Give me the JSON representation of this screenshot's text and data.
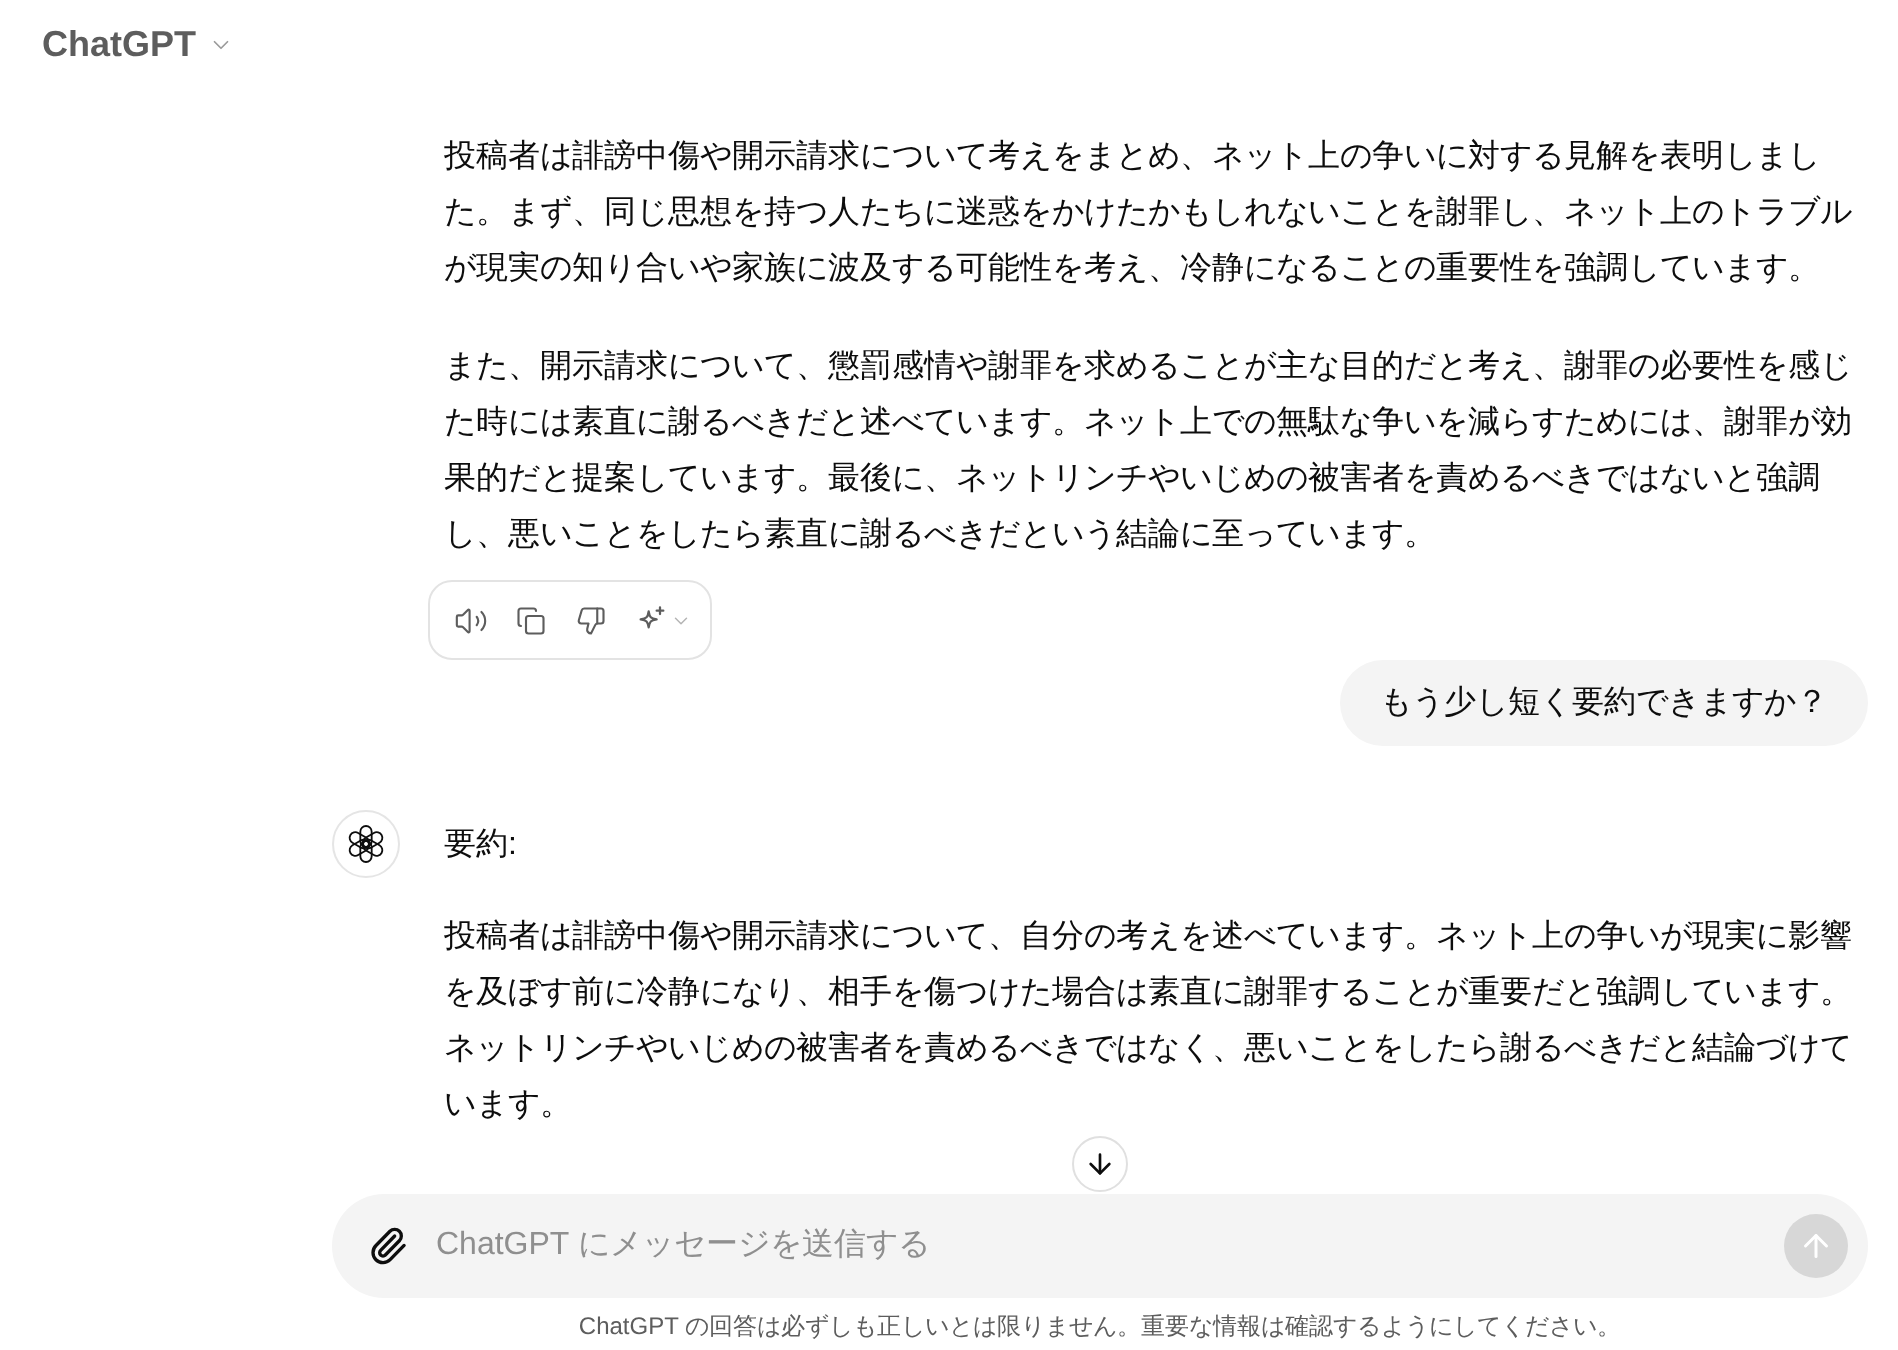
{
  "header": {
    "title": "ChatGPT"
  },
  "messages": [
    {
      "kind": "assistant",
      "avatar_visible": false,
      "paragraphs": [
        "投稿者は誹謗中傷や開示請求について考えをまとめ、ネット上の争いに対する見解を表明しました。まず、同じ思想を持つ人たちに迷惑をかけたかもしれないことを謝罪し、ネット上のトラブルが現実の知り合いや家族に波及する可能性を考え、冷静になることの重要性を強調しています。",
        "また、開示請求について、懲罰感情や謝罪を求めることが主な目的だと考え、謝罪の必要性を感じた時には素直に謝るべきだと述べています。ネット上での無駄な争いを減らすためには、謝罪が効果的だと提案しています。最後に、ネットリンチやいじめの被害者を責めるべきではないと強調し、悪いことをしたら素直に謝るべきだという結論に至っています。"
      ],
      "actions": [
        {
          "kind": "read_aloud"
        },
        {
          "kind": "copy"
        },
        {
          "kind": "dislike"
        },
        {
          "kind": "regenerate"
        }
      ]
    },
    {
      "kind": "user",
      "text": "もう少し短く要約できますか？"
    },
    {
      "kind": "assistant",
      "avatar_visible": true,
      "paragraphs": [
        "要約:",
        "投稿者は誹謗中傷や開示請求について、自分の考えを述べています。ネット上の争いが現実に影響を及ぼす前に冷静になり、相手を傷つけた場合は素直に謝罪することが重要だと強調しています。ネットリンチやいじめの被害者を責めるべきではなく、悪いことをしたら謝るべきだと結論づけています。"
      ]
    }
  ],
  "composer": {
    "placeholder": "ChatGPT にメッセージを送信する",
    "send_disabled": true
  },
  "disclaimer": "ChatGPT の回答は必ずしも正しいとは限りません。重要な情報は確認するようにしてください。"
}
